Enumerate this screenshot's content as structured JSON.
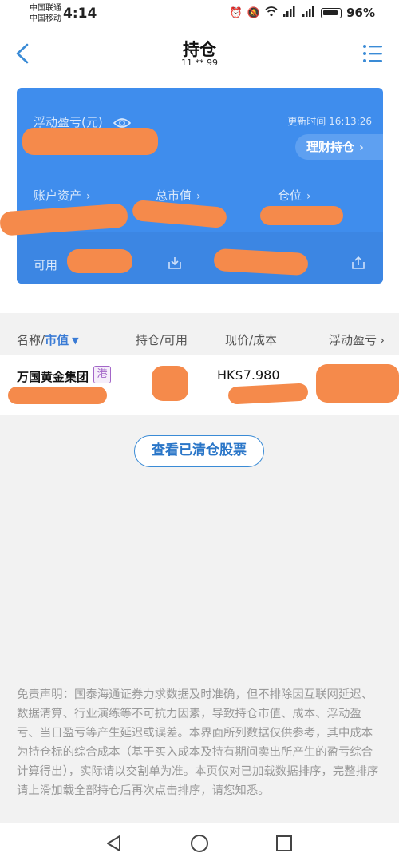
{
  "status_bar": {
    "carrier_1": "中国联通",
    "carrier_2": "中国移动",
    "time": "4:14",
    "battery": "96%"
  },
  "nav": {
    "title": "持仓",
    "subtitle": "11 ** 99"
  },
  "summary": {
    "floating_pl_label": "浮动盈亏(元)",
    "update_time": "更新时间 16:13:26",
    "wealth_button": "理财持仓",
    "assets_label": "账户资产",
    "market_value_label": "总市值",
    "position_label": "仓位",
    "available_label": "可用"
  },
  "table": {
    "col_name": "名称",
    "col_sep": "/",
    "col_mv": "市值",
    "col_hold": "持仓/可用",
    "col_price": "现价/成本",
    "col_pl": "浮动盈亏"
  },
  "rows": [
    {
      "name": "万国黄金集团",
      "market": "港",
      "price": "HK$7.980"
    }
  ],
  "cleared_button": "查看已清仓股票",
  "disclaimer": "免责声明：国泰海通证券力求数据及时准确，但不排除因互联网延迟、数据清算、行业演练等不可抗力因素，导致持仓市值、成本、浮动盈亏、当日盈亏等产生延迟或误差。本界面所列数据仅供参考，其中成本为持仓标的综合成本（基于买入成本及持有期间卖出所产生的盈亏综合计算得出），实际请以交割单为准。本页仅对已加载数据排序，完整排序请上滑加载全部持仓后再次点击排序，请您知悉。"
}
